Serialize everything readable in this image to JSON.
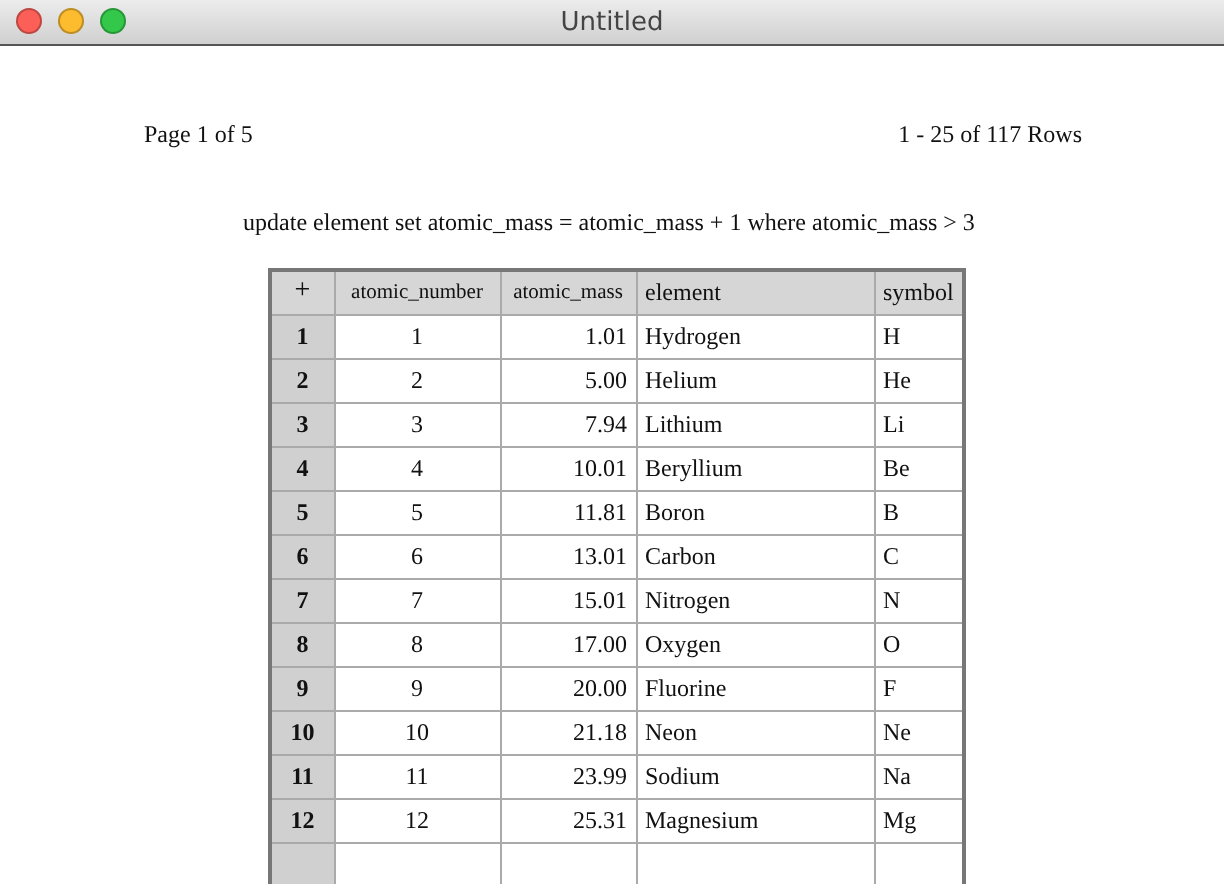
{
  "window": {
    "title": "Untitled"
  },
  "pager": {
    "page": "Page 1 of 5",
    "rows": "1 - 25 of 117 Rows"
  },
  "query": "update element set atomic_mass = atomic_mass + 1 where atomic_mass > 3",
  "table": {
    "corner": "+",
    "columns": [
      "atomic_number",
      "atomic_mass",
      "element",
      "symbol"
    ],
    "rows": [
      {
        "index": "1",
        "cells": [
          "1",
          "1.01",
          "Hydrogen",
          "H"
        ]
      },
      {
        "index": "2",
        "cells": [
          "2",
          "5.00",
          "Helium",
          "He"
        ]
      },
      {
        "index": "3",
        "cells": [
          "3",
          "7.94",
          "Lithium",
          "Li"
        ]
      },
      {
        "index": "4",
        "cells": [
          "4",
          "10.01",
          "Beryllium",
          "Be"
        ]
      },
      {
        "index": "5",
        "cells": [
          "5",
          "11.81",
          "Boron",
          "B"
        ]
      },
      {
        "index": "6",
        "cells": [
          "6",
          "13.01",
          "Carbon",
          "C"
        ]
      },
      {
        "index": "7",
        "cells": [
          "7",
          "15.01",
          "Nitrogen",
          "N"
        ]
      },
      {
        "index": "8",
        "cells": [
          "8",
          "17.00",
          "Oxygen",
          "O"
        ]
      },
      {
        "index": "9",
        "cells": [
          "9",
          "20.00",
          "Fluorine",
          "F"
        ]
      },
      {
        "index": "10",
        "cells": [
          "10",
          "21.18",
          "Neon",
          "Ne"
        ]
      },
      {
        "index": "11",
        "cells": [
          "11",
          "23.99",
          "Sodium",
          "Na"
        ]
      },
      {
        "index": "12",
        "cells": [
          "12",
          "25.31",
          "Magnesium",
          "Mg"
        ]
      }
    ]
  }
}
